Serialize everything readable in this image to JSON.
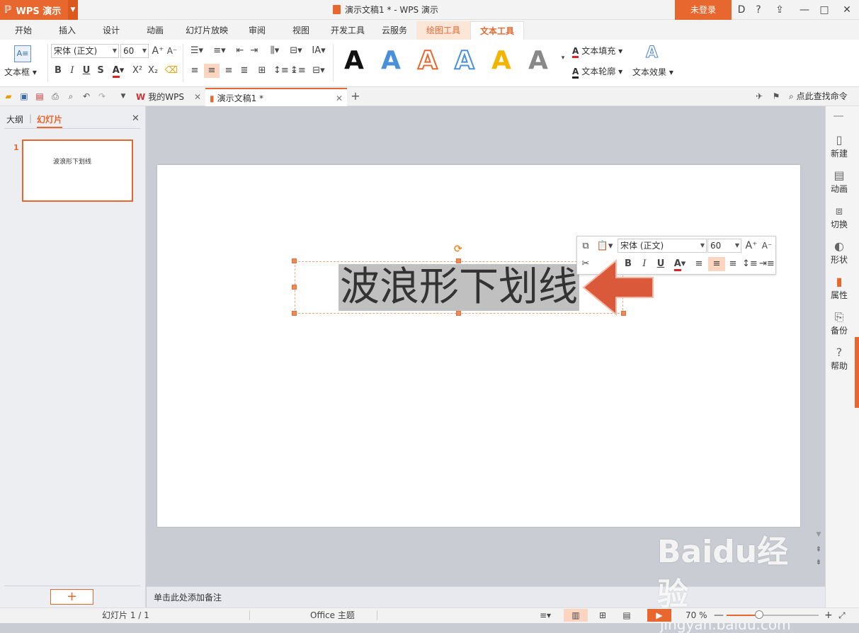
{
  "app": {
    "name": "WPS 演示",
    "logo_glyph": "ℙ"
  },
  "window": {
    "title": "演示文稿1 * - WPS 演示",
    "login": "未登录",
    "controls": [
      "D",
      "?",
      "⇪",
      "—",
      "□",
      "✕"
    ]
  },
  "ribbon_tabs": [
    "开始",
    "插入",
    "设计",
    "动画",
    "幻灯片放映",
    "审阅",
    "视图",
    "开发工具",
    "云服务",
    "绘图工具",
    "文本工具"
  ],
  "active_tab": "文本工具",
  "ribbon": {
    "textbox_label": "文本框",
    "font_name": "宋体 (正文)",
    "font_size": "60",
    "text_fill": "文本填充",
    "text_outline": "文本轮廓",
    "text_effect": "文本效果",
    "style_letter": "A"
  },
  "doc_tabs": [
    {
      "label": "我的WPS"
    },
    {
      "label": "演示文稿1 *"
    }
  ],
  "search_label": "点此查找命令",
  "left_panel": {
    "tab_outline": "大纲",
    "tab_slides": "幻灯片",
    "slide_number": "1",
    "thumb_text": "波浪形下划线",
    "add_label": "+"
  },
  "slide": {
    "text": "波浪形下划线"
  },
  "mini_toolbar": {
    "font_name": "宋体 (正文)",
    "font_size": "60"
  },
  "notes_placeholder": "单击此处添加备注",
  "right_sidebar": [
    {
      "label": "新建",
      "icon": "new-doc-icon"
    },
    {
      "label": "动画",
      "icon": "animation-icon"
    },
    {
      "label": "切换",
      "icon": "transition-icon"
    },
    {
      "label": "形状",
      "icon": "shape-icon"
    },
    {
      "label": "属性",
      "icon": "properties-icon"
    },
    {
      "label": "备份",
      "icon": "backup-icon"
    },
    {
      "label": "帮助",
      "icon": "help-icon"
    }
  ],
  "status": {
    "slide_count": "幻灯片 1 / 1",
    "theme": "Office 主题",
    "zoom": "70 %"
  },
  "watermark": {
    "text": "Baidu经验",
    "url": "jingyan.baidu.com"
  },
  "colors": {
    "accent": "#e8672e",
    "style_blue": "#4a90d9",
    "style_orange": "#e8672e",
    "style_yellow": "#f2b400",
    "style_gray": "#888888"
  }
}
